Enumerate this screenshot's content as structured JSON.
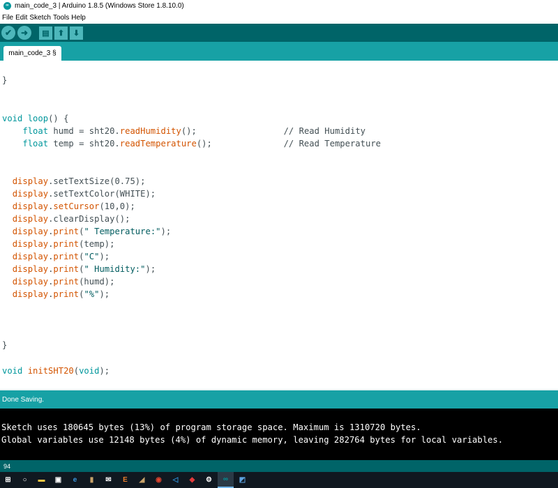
{
  "window": {
    "title": "main_code_3 | Arduino 1.8.5 (Windows Store 1.8.10.0)",
    "logo_glyph": "∞"
  },
  "menu": [
    "File",
    "Edit",
    "Sketch",
    "Tools",
    "Help"
  ],
  "toolbar": {
    "verify_icon": "✔",
    "upload_icon": "➜",
    "new_icon": "▤",
    "open_icon": "⬆",
    "save_icon": "⬇"
  },
  "tabs": [
    {
      "label": "main_code_3 §"
    }
  ],
  "code": [
    {
      "parts": [
        [
          "cm",
          "}"
        ]
      ]
    },
    {
      "parts": [
        [
          "kw",
          "void"
        ],
        [
          "cm",
          " "
        ],
        [
          "kw",
          "loop"
        ],
        [
          "cm",
          "() {"
        ]
      ]
    },
    {
      "parts": [
        [
          "cm",
          "    "
        ],
        [
          "kw",
          "float"
        ],
        [
          "cm",
          " humd = sht20."
        ],
        [
          "fn",
          "readHumidity"
        ],
        [
          "cm",
          "();                 // Read Humidity"
        ]
      ]
    },
    {
      "parts": [
        [
          "cm",
          "    "
        ],
        [
          "kw",
          "float"
        ],
        [
          "cm",
          " temp = sht20."
        ],
        [
          "fn",
          "readTemperature"
        ],
        [
          "cm",
          "();              // Read Temperature"
        ]
      ]
    },
    {
      "parts": [
        [
          "cm",
          "  "
        ],
        [
          "fn",
          "display"
        ],
        [
          "cm",
          ".setTextSize(0.75);"
        ]
      ]
    },
    {
      "parts": [
        [
          "cm",
          "  "
        ],
        [
          "fn",
          "display"
        ],
        [
          "cm",
          ".setTextColor(WHITE);"
        ]
      ]
    },
    {
      "parts": [
        [
          "cm",
          "  "
        ],
        [
          "fn",
          "display"
        ],
        [
          "cm",
          "."
        ],
        [
          "fn",
          "setCursor"
        ],
        [
          "cm",
          "(10,0);"
        ]
      ]
    },
    {
      "parts": [
        [
          "cm",
          "  "
        ],
        [
          "fn",
          "display"
        ],
        [
          "cm",
          ".clearDisplay();"
        ]
      ]
    },
    {
      "parts": [
        [
          "cm",
          "  "
        ],
        [
          "fn",
          "display"
        ],
        [
          "cm",
          "."
        ],
        [
          "fn",
          "print"
        ],
        [
          "cm",
          "("
        ],
        [
          "str",
          "\" Temperature:\""
        ],
        [
          "cm",
          ");"
        ]
      ]
    },
    {
      "parts": [
        [
          "cm",
          "  "
        ],
        [
          "fn",
          "display"
        ],
        [
          "cm",
          "."
        ],
        [
          "fn",
          "print"
        ],
        [
          "cm",
          "(temp);"
        ]
      ]
    },
    {
      "parts": [
        [
          "cm",
          "  "
        ],
        [
          "fn",
          "display"
        ],
        [
          "cm",
          "."
        ],
        [
          "fn",
          "print"
        ],
        [
          "cm",
          "("
        ],
        [
          "str",
          "\"C\""
        ],
        [
          "cm",
          ");"
        ]
      ]
    },
    {
      "parts": [
        [
          "cm",
          "  "
        ],
        [
          "fn",
          "display"
        ],
        [
          "cm",
          "."
        ],
        [
          "fn",
          "print"
        ],
        [
          "cm",
          "("
        ],
        [
          "str",
          "\" Humidity:\""
        ],
        [
          "cm",
          ");"
        ]
      ]
    },
    {
      "parts": [
        [
          "cm",
          "  "
        ],
        [
          "fn",
          "display"
        ],
        [
          "cm",
          "."
        ],
        [
          "fn",
          "print"
        ],
        [
          "cm",
          "(humd);"
        ]
      ]
    },
    {
      "parts": [
        [
          "cm",
          "  "
        ],
        [
          "fn",
          "display"
        ],
        [
          "cm",
          "."
        ],
        [
          "fn",
          "print"
        ],
        [
          "cm",
          "("
        ],
        [
          "str",
          "\"%\""
        ],
        [
          "cm",
          ");"
        ]
      ]
    },
    {
      "parts": [
        [
          "cm",
          "}"
        ]
      ]
    },
    {
      "parts": [
        [
          "kw",
          "void"
        ],
        [
          "cm",
          " "
        ],
        [
          "fn",
          "initSHT20"
        ],
        [
          "cm",
          "("
        ],
        [
          "kw",
          "void"
        ],
        [
          "cm",
          ");"
        ]
      ]
    }
  ],
  "status": {
    "message": "Done Saving."
  },
  "console": {
    "lines": [
      "Sketch uses 180645 bytes (13%) of program storage space. Maximum is 1310720 bytes.",
      "Global variables use 12148 bytes (4%) of dynamic memory, leaving 282764 bytes for local variables."
    ]
  },
  "line_number": "94",
  "taskbar": {
    "items": [
      {
        "name": "start-icon",
        "glyph": "⊞",
        "color": "#ffffff"
      },
      {
        "name": "search-icon",
        "glyph": "○",
        "color": "#ffffff"
      },
      {
        "name": "file-explorer-icon",
        "glyph": "▬",
        "color": "#f5c542"
      },
      {
        "name": "store-icon",
        "glyph": "▣",
        "color": "#ffffff"
      },
      {
        "name": "edge-icon",
        "glyph": "e",
        "color": "#3a96dd"
      },
      {
        "name": "app-icon",
        "glyph": "▮",
        "color": "#c9a36a"
      },
      {
        "name": "mail-icon",
        "glyph": "✉",
        "color": "#ffffff"
      },
      {
        "name": "editor-icon",
        "glyph": "E",
        "color": "#e87d2d"
      },
      {
        "name": "app2-icon",
        "glyph": "◢",
        "color": "#c9a36a"
      },
      {
        "name": "chrome-icon",
        "glyph": "◉",
        "color": "#e0452f"
      },
      {
        "name": "vscode-icon",
        "glyph": "◁",
        "color": "#2c8fd6"
      },
      {
        "name": "app3-icon",
        "glyph": "◆",
        "color": "#e23b3b"
      },
      {
        "name": "settings-icon",
        "glyph": "⚙",
        "color": "#ffffff"
      },
      {
        "name": "arduino-icon",
        "glyph": "∞",
        "color": "#00979c",
        "active": true
      },
      {
        "name": "app4-icon",
        "glyph": "◩",
        "color": "#5ea3e0"
      }
    ]
  }
}
